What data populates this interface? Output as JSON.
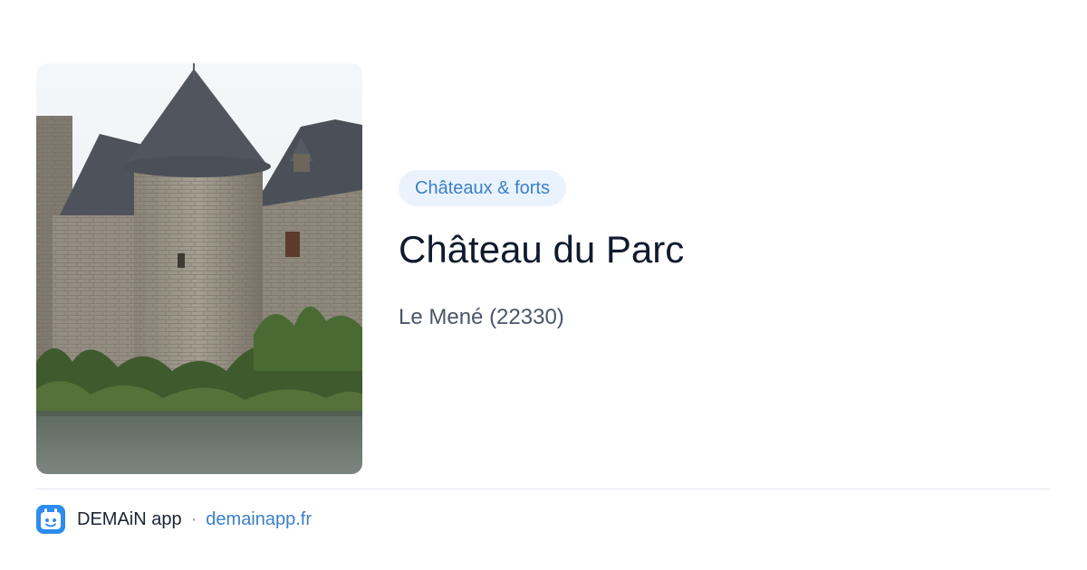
{
  "card": {
    "category": "Châteaux & forts",
    "title": "Château du Parc",
    "location": "Le Mené (22330)"
  },
  "photo": {
    "subject": "stone chateau with slate-roofed towers reflected beside a moat"
  },
  "footer": {
    "app_name": "DEMAiN app",
    "separator": "·",
    "link": "demainapp.fr",
    "icon": "demain-app-logo-icon"
  },
  "colors": {
    "accent": "#3b7fc9",
    "pill_bg": "#eaf3fd",
    "title": "#0f1b2d",
    "subtitle": "#4a5668",
    "divider": "#dfe7ee",
    "logo_blue": "#2d8cf0"
  }
}
